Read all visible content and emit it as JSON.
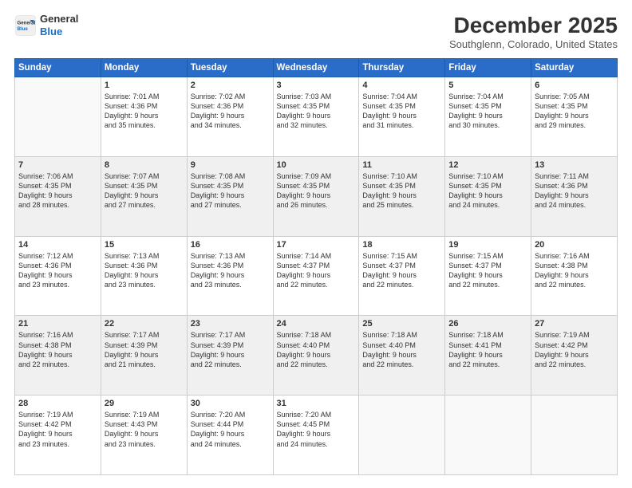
{
  "header": {
    "logo_line1": "General",
    "logo_line2": "Blue",
    "month": "December 2025",
    "location": "Southglenn, Colorado, United States"
  },
  "days_of_week": [
    "Sunday",
    "Monday",
    "Tuesday",
    "Wednesday",
    "Thursday",
    "Friday",
    "Saturday"
  ],
  "weeks": [
    [
      {
        "num": "",
        "info": ""
      },
      {
        "num": "1",
        "info": "Sunrise: 7:01 AM\nSunset: 4:36 PM\nDaylight: 9 hours\nand 35 minutes."
      },
      {
        "num": "2",
        "info": "Sunrise: 7:02 AM\nSunset: 4:36 PM\nDaylight: 9 hours\nand 34 minutes."
      },
      {
        "num": "3",
        "info": "Sunrise: 7:03 AM\nSunset: 4:35 PM\nDaylight: 9 hours\nand 32 minutes."
      },
      {
        "num": "4",
        "info": "Sunrise: 7:04 AM\nSunset: 4:35 PM\nDaylight: 9 hours\nand 31 minutes."
      },
      {
        "num": "5",
        "info": "Sunrise: 7:04 AM\nSunset: 4:35 PM\nDaylight: 9 hours\nand 30 minutes."
      },
      {
        "num": "6",
        "info": "Sunrise: 7:05 AM\nSunset: 4:35 PM\nDaylight: 9 hours\nand 29 minutes."
      }
    ],
    [
      {
        "num": "7",
        "info": "Sunrise: 7:06 AM\nSunset: 4:35 PM\nDaylight: 9 hours\nand 28 minutes."
      },
      {
        "num": "8",
        "info": "Sunrise: 7:07 AM\nSunset: 4:35 PM\nDaylight: 9 hours\nand 27 minutes."
      },
      {
        "num": "9",
        "info": "Sunrise: 7:08 AM\nSunset: 4:35 PM\nDaylight: 9 hours\nand 27 minutes."
      },
      {
        "num": "10",
        "info": "Sunrise: 7:09 AM\nSunset: 4:35 PM\nDaylight: 9 hours\nand 26 minutes."
      },
      {
        "num": "11",
        "info": "Sunrise: 7:10 AM\nSunset: 4:35 PM\nDaylight: 9 hours\nand 25 minutes."
      },
      {
        "num": "12",
        "info": "Sunrise: 7:10 AM\nSunset: 4:35 PM\nDaylight: 9 hours\nand 24 minutes."
      },
      {
        "num": "13",
        "info": "Sunrise: 7:11 AM\nSunset: 4:36 PM\nDaylight: 9 hours\nand 24 minutes."
      }
    ],
    [
      {
        "num": "14",
        "info": "Sunrise: 7:12 AM\nSunset: 4:36 PM\nDaylight: 9 hours\nand 23 minutes."
      },
      {
        "num": "15",
        "info": "Sunrise: 7:13 AM\nSunset: 4:36 PM\nDaylight: 9 hours\nand 23 minutes."
      },
      {
        "num": "16",
        "info": "Sunrise: 7:13 AM\nSunset: 4:36 PM\nDaylight: 9 hours\nand 23 minutes."
      },
      {
        "num": "17",
        "info": "Sunrise: 7:14 AM\nSunset: 4:37 PM\nDaylight: 9 hours\nand 22 minutes."
      },
      {
        "num": "18",
        "info": "Sunrise: 7:15 AM\nSunset: 4:37 PM\nDaylight: 9 hours\nand 22 minutes."
      },
      {
        "num": "19",
        "info": "Sunrise: 7:15 AM\nSunset: 4:37 PM\nDaylight: 9 hours\nand 22 minutes."
      },
      {
        "num": "20",
        "info": "Sunrise: 7:16 AM\nSunset: 4:38 PM\nDaylight: 9 hours\nand 22 minutes."
      }
    ],
    [
      {
        "num": "21",
        "info": "Sunrise: 7:16 AM\nSunset: 4:38 PM\nDaylight: 9 hours\nand 22 minutes."
      },
      {
        "num": "22",
        "info": "Sunrise: 7:17 AM\nSunset: 4:39 PM\nDaylight: 9 hours\nand 21 minutes."
      },
      {
        "num": "23",
        "info": "Sunrise: 7:17 AM\nSunset: 4:39 PM\nDaylight: 9 hours\nand 22 minutes."
      },
      {
        "num": "24",
        "info": "Sunrise: 7:18 AM\nSunset: 4:40 PM\nDaylight: 9 hours\nand 22 minutes."
      },
      {
        "num": "25",
        "info": "Sunrise: 7:18 AM\nSunset: 4:40 PM\nDaylight: 9 hours\nand 22 minutes."
      },
      {
        "num": "26",
        "info": "Sunrise: 7:18 AM\nSunset: 4:41 PM\nDaylight: 9 hours\nand 22 minutes."
      },
      {
        "num": "27",
        "info": "Sunrise: 7:19 AM\nSunset: 4:42 PM\nDaylight: 9 hours\nand 22 minutes."
      }
    ],
    [
      {
        "num": "28",
        "info": "Sunrise: 7:19 AM\nSunset: 4:42 PM\nDaylight: 9 hours\nand 23 minutes."
      },
      {
        "num": "29",
        "info": "Sunrise: 7:19 AM\nSunset: 4:43 PM\nDaylight: 9 hours\nand 23 minutes."
      },
      {
        "num": "30",
        "info": "Sunrise: 7:20 AM\nSunset: 4:44 PM\nDaylight: 9 hours\nand 24 minutes."
      },
      {
        "num": "31",
        "info": "Sunrise: 7:20 AM\nSunset: 4:45 PM\nDaylight: 9 hours\nand 24 minutes."
      },
      {
        "num": "",
        "info": ""
      },
      {
        "num": "",
        "info": ""
      },
      {
        "num": "",
        "info": ""
      }
    ]
  ]
}
